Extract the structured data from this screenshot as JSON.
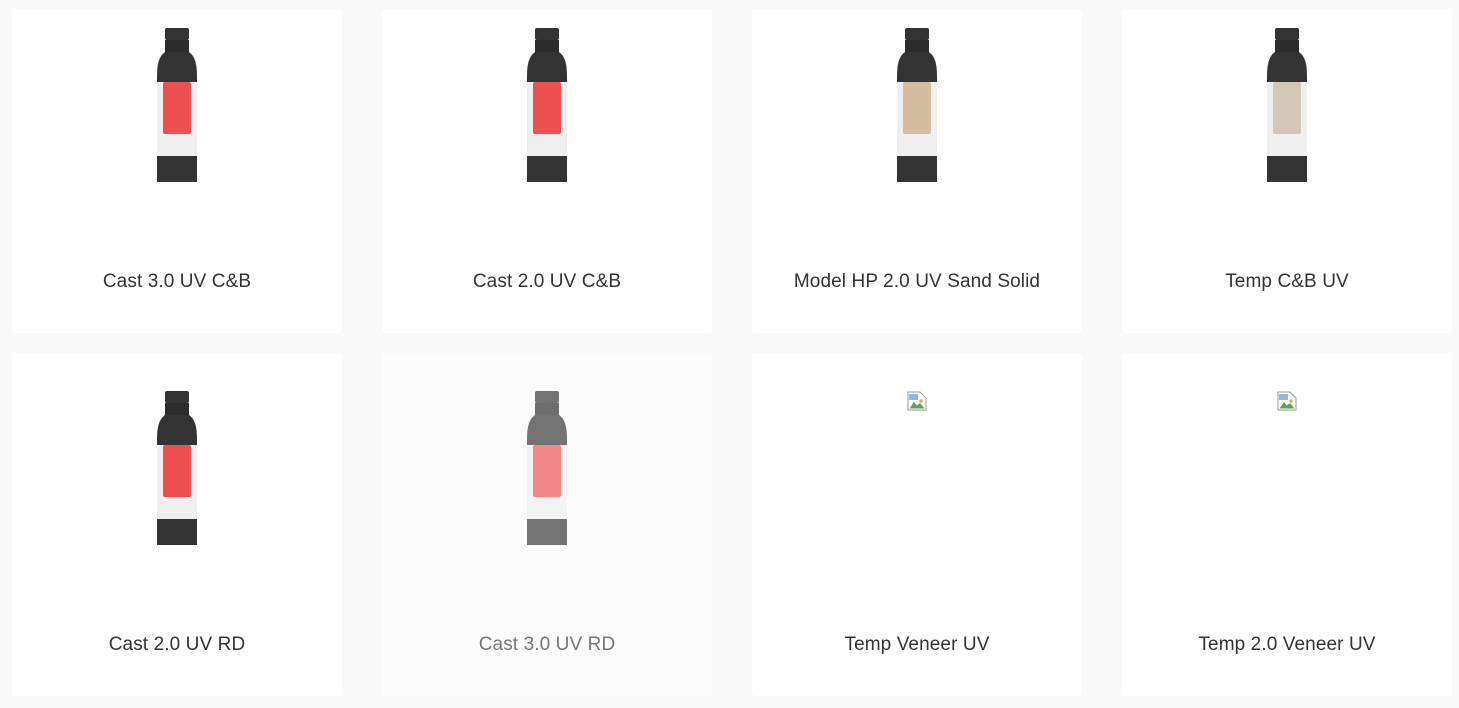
{
  "products": [
    {
      "name": "Cast 3.0 UV C&B",
      "label_color": "#ec5050",
      "image": "bottle",
      "dimmed": false
    },
    {
      "name": "Cast 2.0 UV C&B",
      "label_color": "#ec5050",
      "image": "bottle",
      "dimmed": false
    },
    {
      "name": "Model HP 2.0 UV Sand Solid",
      "label_color": "#d3bd9e",
      "image": "bottle",
      "dimmed": false
    },
    {
      "name": "Temp C&B UV",
      "label_color": "#d3c8b5",
      "image": "bottle",
      "dimmed": false
    },
    {
      "name": "Cast 2.0 UV RD",
      "label_color": "#ec5050",
      "image": "bottle",
      "dimmed": false
    },
    {
      "name": "Cast 3.0 UV RD",
      "label_color": "#ec5050",
      "image": "bottle",
      "dimmed": true
    },
    {
      "name": "Temp Veneer UV",
      "label_color": "",
      "image": "broken-image-icon",
      "dimmed": false
    },
    {
      "name": "Temp 2.0 Veneer UV",
      "label_color": "",
      "image": "broken-image-icon",
      "dimmed": false
    }
  ],
  "colors": {
    "background": "#f9f9f9",
    "card": "#ffffff",
    "bottle_body": "#333333",
    "bottle_sleeve": "#efefef",
    "text": "#333333"
  }
}
